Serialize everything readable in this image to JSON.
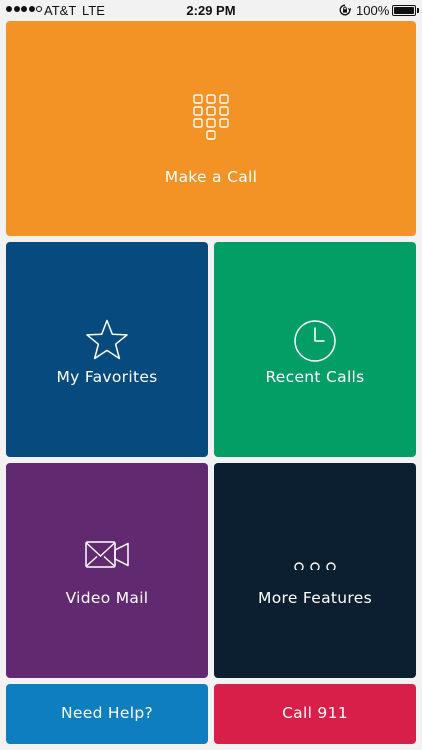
{
  "status_bar": {
    "carrier": "AT&T",
    "network": "LTE",
    "time": "2:29 PM",
    "battery": "100%",
    "battery_level": 1.0,
    "signal_bars_filled": 4,
    "signal_bars_total": 5
  },
  "tiles": {
    "make_call": {
      "label": "Make a Call",
      "icon": "keypad-icon",
      "color": "#f39325"
    },
    "favorites": {
      "label": "My Favorites",
      "icon": "star-icon",
      "color": "#064a7e"
    },
    "recent_calls": {
      "label": "Recent Calls",
      "icon": "clock-icon",
      "color": "#039e66"
    },
    "video_mail": {
      "label": "Video Mail",
      "icon": "video-camera-icon",
      "color": "#612a70"
    },
    "more_features": {
      "label": "More Features",
      "icon": "more-dots-icon",
      "color": "#0b1f30"
    },
    "need_help": {
      "label": "Need Help?",
      "color": "#0e7ec0"
    },
    "call_911": {
      "label": "Call 911",
      "color": "#d81f49"
    }
  }
}
